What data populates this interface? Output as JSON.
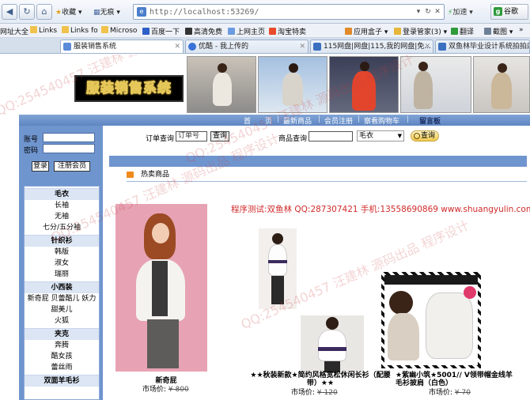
{
  "browser": {
    "toolbar": {
      "back": "◀",
      "refresh": "↻",
      "home": "⌂",
      "favorites_label": "收藏",
      "mode_label": "无痕",
      "url": "http://localhost:53269/",
      "speed_label": "加速",
      "ext_label": "谷歌",
      "addr_icon": "e",
      "ext_icon": "g"
    },
    "favorites": [
      "网址大全",
      "Links",
      "Links fo",
      "Microso",
      "百度一下",
      "高清免费",
      "上网主页",
      "淘宝特卖",
      "应用盒子",
      "登录管家(3)",
      "翻译",
      "截图"
    ],
    "tabs": [
      {
        "label": "服装销售系统",
        "active": true
      },
      {
        "label": "优酷 - 我上传的",
        "active": false
      },
      {
        "label": "115网盘|网盘|115,我的网盘|免...",
        "active": false
      },
      {
        "label": "双鱼林毕业设计系统拍拍店",
        "active": false
      }
    ]
  },
  "site": {
    "logo_text": "服装销售系统",
    "nav": [
      "首　　页",
      "最新商品",
      "会员注册",
      "察看购物车",
      "留言板"
    ],
    "nav_sep": "|"
  },
  "login": {
    "account_label": "账号",
    "password_label": "密码",
    "login_button": "登录",
    "register_button": "注册会员"
  },
  "categories": [
    {
      "name": "毛衣",
      "items": [
        "长袖",
        "无袖",
        "七分/五分袖"
      ]
    },
    {
      "name": "针织衫",
      "items": [
        "韩版",
        "淑女",
        "瑞丽"
      ]
    },
    {
      "name": "小西装",
      "items": [
        "新奇屁 贝蕾酷儿 妖力",
        "甜美儿",
        "火狐"
      ]
    },
    {
      "name": "夹克",
      "items": [
        "奔腾",
        "酷女孩",
        "蕾丝雨"
      ]
    },
    {
      "name": "双面羊毛衫",
      "items": []
    }
  ],
  "search": {
    "order_label": "订单查询",
    "order_placeholder": "订单号",
    "order_button": "查询",
    "product_label": "商品查询",
    "category_selected": "毛衣",
    "go_button": "查询"
  },
  "hot_section": {
    "title": "热卖商品"
  },
  "ad_text": "程序测试:双鱼林 QQ:287307421 手机:13558690869 www.shuangyulin.com",
  "products": [
    {
      "name": "新奇屁",
      "price_label": "市场价:",
      "price": "¥ 800"
    },
    {
      "name": "★★秋装新款★简约风格宽松休闲长衫（配腰带）★★",
      "price_label": "市场价:",
      "price": "¥ 120"
    },
    {
      "name": "★紫幽小筑★5001// V领带帽金线羊毛衫披肩（白色）",
      "price_label": "市场价:",
      "price": "¥ 70"
    }
  ],
  "watermark_text": "QQ:254540457 汪建林 源码出品 程序设计"
}
